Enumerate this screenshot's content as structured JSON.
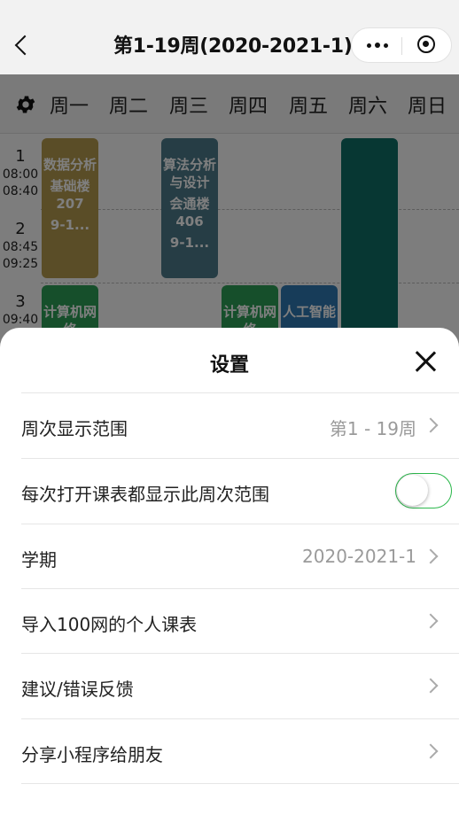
{
  "nav": {
    "title": "第1-19周(2020-2021-1)"
  },
  "timetable": {
    "days": [
      "周一",
      "周二",
      "周三",
      "周四",
      "周五",
      "周六",
      "周日"
    ],
    "periods": [
      {
        "num": "1",
        "start": "08:00",
        "end": "08:40"
      },
      {
        "num": "2",
        "start": "08:45",
        "end": "09:25"
      },
      {
        "num": "3",
        "start": "09:40"
      }
    ],
    "courses": [
      {
        "name": "数据分析",
        "place": "基础楼207",
        "weeks": "9-1...",
        "color": "#b59a4e"
      },
      {
        "name": "算法分析与设计",
        "place": "会通楼406",
        "weeks": "9-1...",
        "color": "#4d7a8a"
      },
      {
        "name": "计算机网络",
        "color": "#2c9e56"
      },
      {
        "name": "计算机网络",
        "color": "#2c9e56"
      },
      {
        "name": "人工智能",
        "color": "#2e79b3"
      },
      {
        "name": "",
        "color": "#0f6f66"
      }
    ]
  },
  "settings": {
    "title": "设置",
    "rows": [
      {
        "label": "周次显示范围",
        "value": "第1 - 19周"
      },
      {
        "label": "每次打开课表都显示此周次范围",
        "toggle_on": false
      },
      {
        "label": "学期",
        "value": "2020-2021-1"
      },
      {
        "label": "导入100网的个人课表",
        "value": ""
      },
      {
        "label": "建议/错误反馈",
        "value": ""
      },
      {
        "label": "分享小程序给朋友",
        "value": ""
      }
    ]
  },
  "colors": {
    "accent_green": "#2db84d"
  },
  "icons": [
    "back-icon",
    "more-icon",
    "target-icon",
    "gear-icon",
    "close-icon",
    "chevron-right-icon"
  ]
}
